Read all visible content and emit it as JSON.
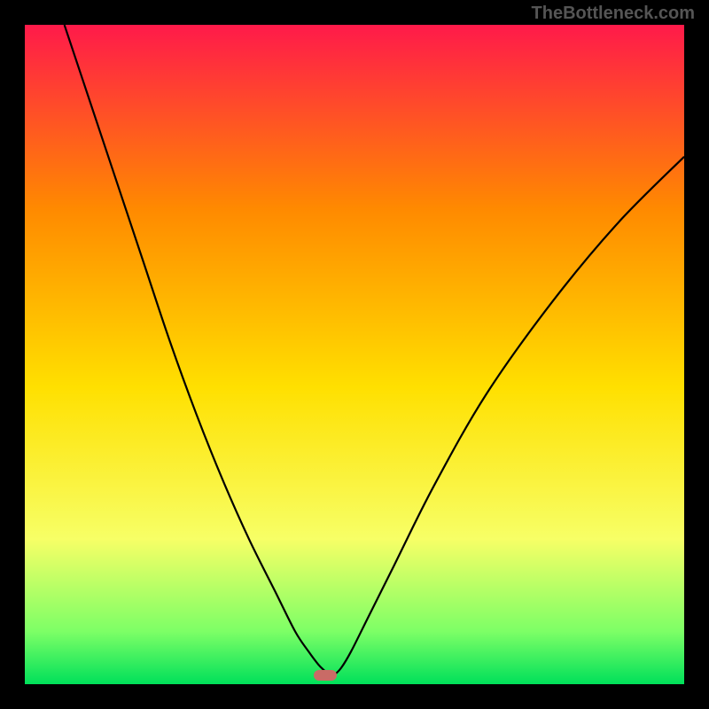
{
  "watermark": "TheBottleneck.com",
  "chart_data": {
    "type": "line",
    "title": "",
    "xlabel": "",
    "ylabel": "",
    "xlim": [
      0,
      100
    ],
    "ylim": [
      0,
      100
    ],
    "grid": false,
    "legend": false,
    "series": [
      {
        "name": "curve",
        "x": [
          6,
          10,
          14,
          18,
          22,
          26,
          30,
          34,
          38,
          41,
          43,
          44.5,
          45.5,
          46.2,
          47,
          48,
          49.5,
          52,
          56,
          62,
          70,
          80,
          90,
          100
        ],
        "y": [
          100,
          88,
          76,
          64,
          52,
          41,
          31,
          22,
          14,
          8,
          5,
          3,
          2,
          1.3,
          1.5,
          2.5,
          5,
          10,
          18,
          30,
          44,
          58,
          70,
          80
        ]
      }
    ],
    "marker": {
      "x": 45.5,
      "y": 1.3
    },
    "background_gradient": [
      "#ff1a4a",
      "#ff8a00",
      "#ffe000",
      "#f7ff66",
      "#7dff66",
      "#00e05a"
    ]
  }
}
